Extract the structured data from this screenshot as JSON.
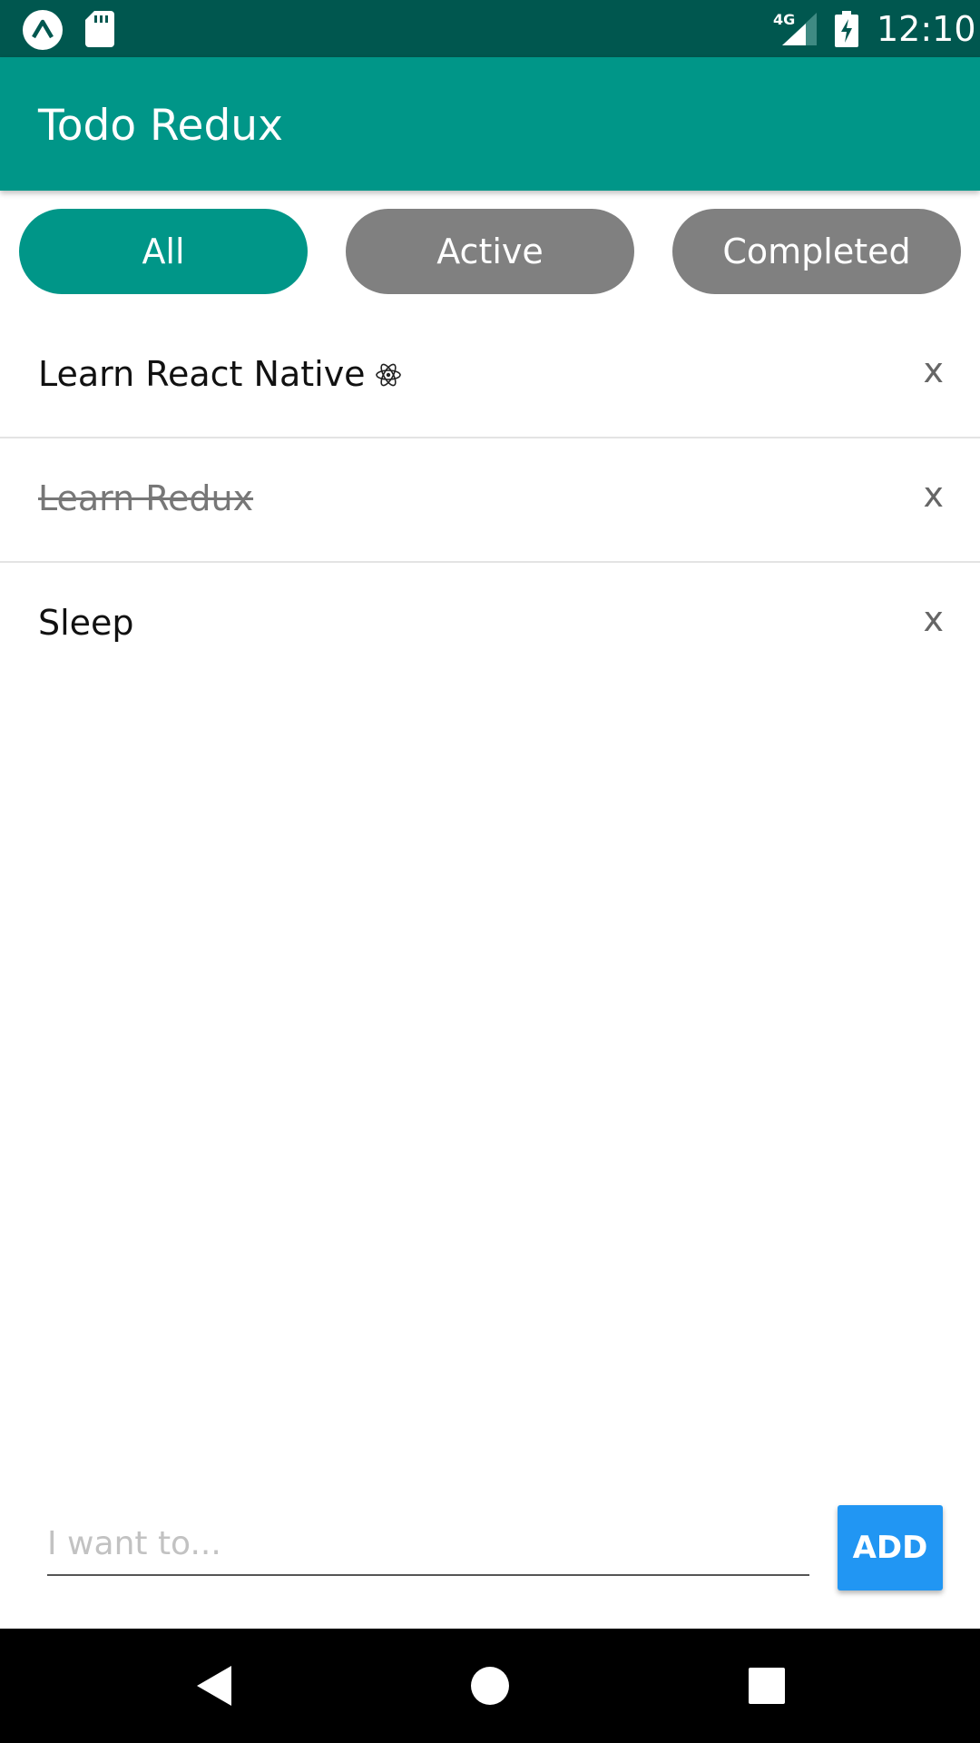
{
  "status_bar": {
    "network": "4G",
    "time": "12:10",
    "icons": [
      "expo-icon",
      "sd-card-icon",
      "signal-icon",
      "battery-charging-icon"
    ]
  },
  "app_bar": {
    "title": "Todo Redux"
  },
  "filters": {
    "items": [
      {
        "label": "All",
        "selected": true
      },
      {
        "label": "Active",
        "selected": false
      },
      {
        "label": "Completed",
        "selected": false
      }
    ],
    "selected_color": "#009688",
    "unselected_color": "#808080"
  },
  "todos": [
    {
      "text": "Learn React Native",
      "completed": false,
      "icon": "atom-icon",
      "remove_label": "x"
    },
    {
      "text": "Learn Redux",
      "completed": true,
      "remove_label": "x"
    },
    {
      "text": "Sleep",
      "completed": false,
      "remove_label": "x"
    }
  ],
  "new_todo": {
    "value": "",
    "placeholder": "I want to...",
    "add_label": "ADD"
  },
  "nav_bar": {
    "buttons": [
      "back-icon",
      "home-icon",
      "recents-icon"
    ]
  },
  "colors": {
    "status_bar": "#00574F",
    "primary": "#009688",
    "accent": "#2196F3"
  }
}
